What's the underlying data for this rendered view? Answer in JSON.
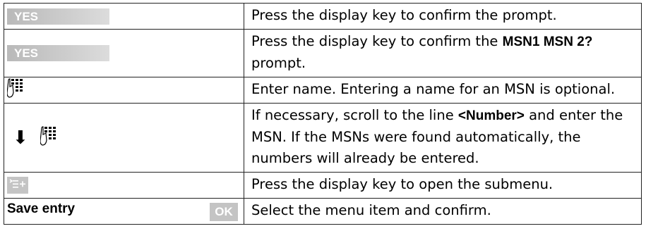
{
  "rows": [
    {
      "key": "YES",
      "desc": "Press the display key to confirm the prompt."
    },
    {
      "key": "YES",
      "desc_before": "Press the display key to confirm the",
      "desc_bold": "MSN1 MSN 2?",
      "desc_after": "prompt."
    },
    {
      "key_icon": "keypad-icon",
      "desc": "Enter name. Entering a name for an MSN is optional."
    },
    {
      "key_icons": [
        "arrow-down-icon",
        "keypad-icon"
      ],
      "desc_before": "If necessary, scroll to the line",
      "desc_bold": "<Number>",
      "desc_after": "and enter the MSN. If the MSNs were found automatically, the numbers will already be entered."
    },
    {
      "key_icon": "menu-icon",
      "desc": "Press the display key to open the submenu."
    },
    {
      "key_label": "Save entry",
      "key_button": "OK",
      "desc": "Select the menu item and confirm."
    }
  ]
}
